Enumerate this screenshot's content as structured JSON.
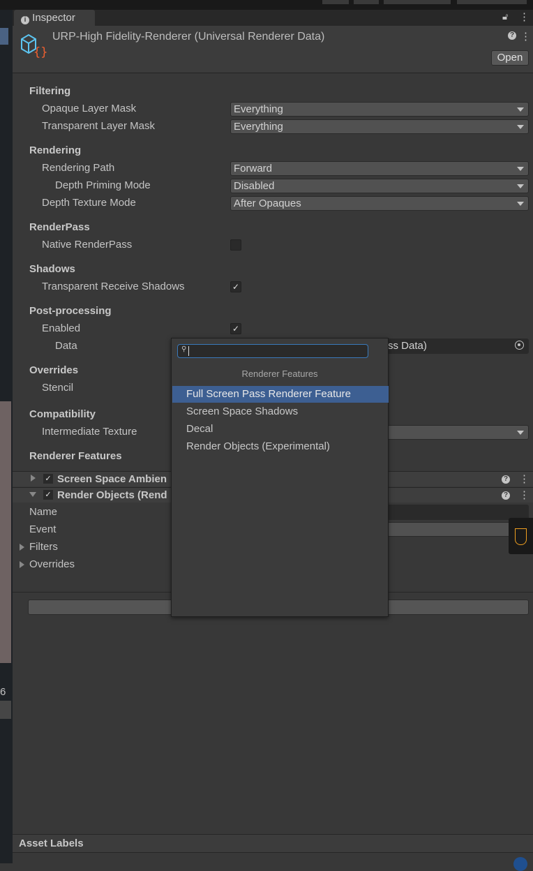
{
  "tab": {
    "title": "Inspector",
    "icon": "info-icon"
  },
  "header": {
    "title": "URP-High Fidelity-Renderer (Universal Renderer Data)",
    "open_label": "Open",
    "asset_icon": "script-asset-icon"
  },
  "sections": {
    "filtering": "Filtering",
    "opaque_label": "Opaque Layer Mask",
    "opaque_value": "Everything",
    "transparent_label": "Transparent Layer Mask",
    "transparent_value": "Everything",
    "rendering": "Rendering",
    "path_label": "Rendering Path",
    "path_value": "Forward",
    "priming_label": "Depth Priming Mode",
    "priming_value": "Disabled",
    "depthtex_label": "Depth Texture Mode",
    "depthtex_value": "After Opaques",
    "renderpass": "RenderPass",
    "native_label": "Native RenderPass",
    "native_checked": false,
    "shadows": "Shadows",
    "receive_label": "Transparent Receive Shadows",
    "receive_checked": true,
    "post": "Post-processing",
    "enabled_label": "Enabled",
    "enabled_checked": true,
    "data_label": "Data",
    "data_value": "ss Data)",
    "overrides": "Overrides",
    "stencil_label": "Stencil",
    "compat": "Compatibility",
    "intermediate_label": "Intermediate Texture",
    "features": "Renderer Features"
  },
  "features": [
    {
      "label": "Screen Space Ambien",
      "checked": true,
      "expanded": false
    },
    {
      "label": "Render Objects (Rend",
      "checked": true,
      "expanded": true
    }
  ],
  "feature_fields": {
    "name": "Name",
    "event": "Event",
    "filters": "Filters",
    "overrides": "Overrides"
  },
  "popup": {
    "search_value": "",
    "title": "Renderer Features",
    "items": [
      "Full Screen Pass Renderer Feature",
      "Screen Space Shadows",
      "Decal",
      "Render Objects (Experimental)"
    ],
    "selected": 0
  },
  "footer": {
    "asset_labels": "Asset Labels"
  },
  "left_strip": {
    "number": "6"
  },
  "colors": {
    "highlight": "#3d5f92",
    "focus": "#3a79bb",
    "accent_orange": "#f0a020"
  }
}
